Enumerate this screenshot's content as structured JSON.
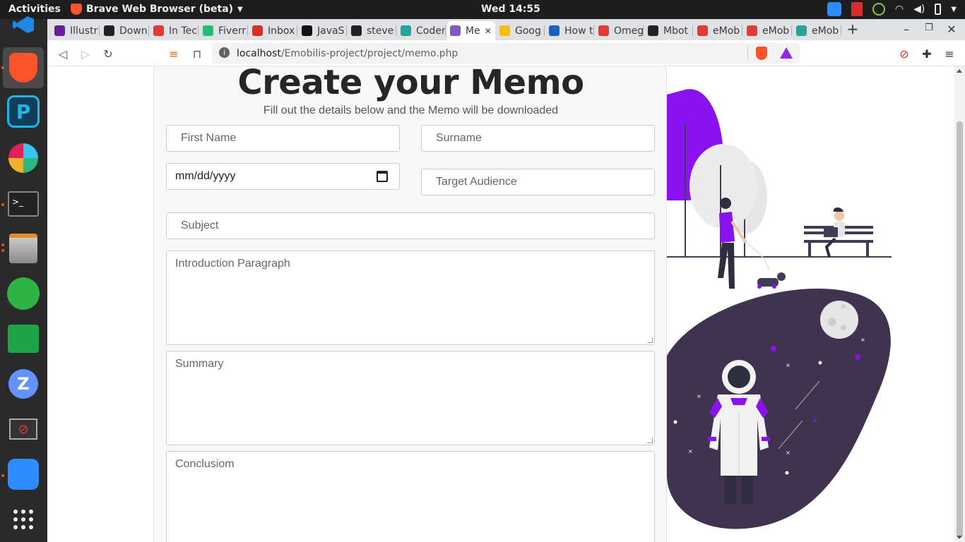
{
  "system": {
    "activities": "Activities",
    "app_name": "Brave Web Browser (beta)",
    "clock": "Wed 14:55"
  },
  "browser": {
    "tabs": [
      {
        "label": "Illustr",
        "color": "#6a1b9a",
        "icon": "github-like"
      },
      {
        "label": "Down",
        "color": "#222222",
        "icon": "circle-c"
      },
      {
        "label": "In Tec",
        "color": "#e53935",
        "icon": "square"
      },
      {
        "label": "Fiverr",
        "color": "#1dbf73",
        "icon": "fiverr"
      },
      {
        "label": "Inbox",
        "color": "#d93025",
        "icon": "gmail"
      },
      {
        "label": "JavaS",
        "color": "#111111",
        "icon": "code"
      },
      {
        "label": "steve",
        "color": "#222222",
        "icon": "github"
      },
      {
        "label": "Coder",
        "color": "#26a69a",
        "icon": "c"
      },
      {
        "label": "Me",
        "color": "#7e57c2",
        "icon": "page",
        "active": true
      },
      {
        "label": "Goog",
        "color": "#fbbc04",
        "icon": "meet"
      },
      {
        "label": "How t",
        "color": "#1565c0",
        "icon": "drop"
      },
      {
        "label": "Omeg",
        "color": "#e53935",
        "icon": "e"
      },
      {
        "label": "Mbot",
        "color": "#222222",
        "icon": "github"
      },
      {
        "label": "eMob",
        "color": "#e53935",
        "icon": "e"
      },
      {
        "label": "eMob",
        "color": "#e53935",
        "icon": "e"
      },
      {
        "label": "eMob",
        "color": "#26a69a",
        "icon": "globe"
      }
    ],
    "close_tab": "✕",
    "new_tab": "+",
    "url_host": "localhost",
    "url_path": "/Emobilis-project/project/memo.php"
  },
  "page": {
    "title": "Create your Memo",
    "subtitle": "Fill out the details below and the Memo will be downloaded",
    "first_name_placeholder": "First Name",
    "surname_placeholder": "Surname",
    "date_placeholder": "mm/dd/yyyy",
    "target_audience_placeholder": "Target Audience",
    "subject_placeholder": "Subject",
    "introduction_placeholder": "Introduction Paragraph",
    "summary_placeholder": "Summary",
    "conclusion_placeholder": "Conclusiom"
  },
  "colors": {
    "accent_purple": "#8b12f0",
    "dark_blob": "#3f3350",
    "brave_orange": "#fb542b"
  }
}
